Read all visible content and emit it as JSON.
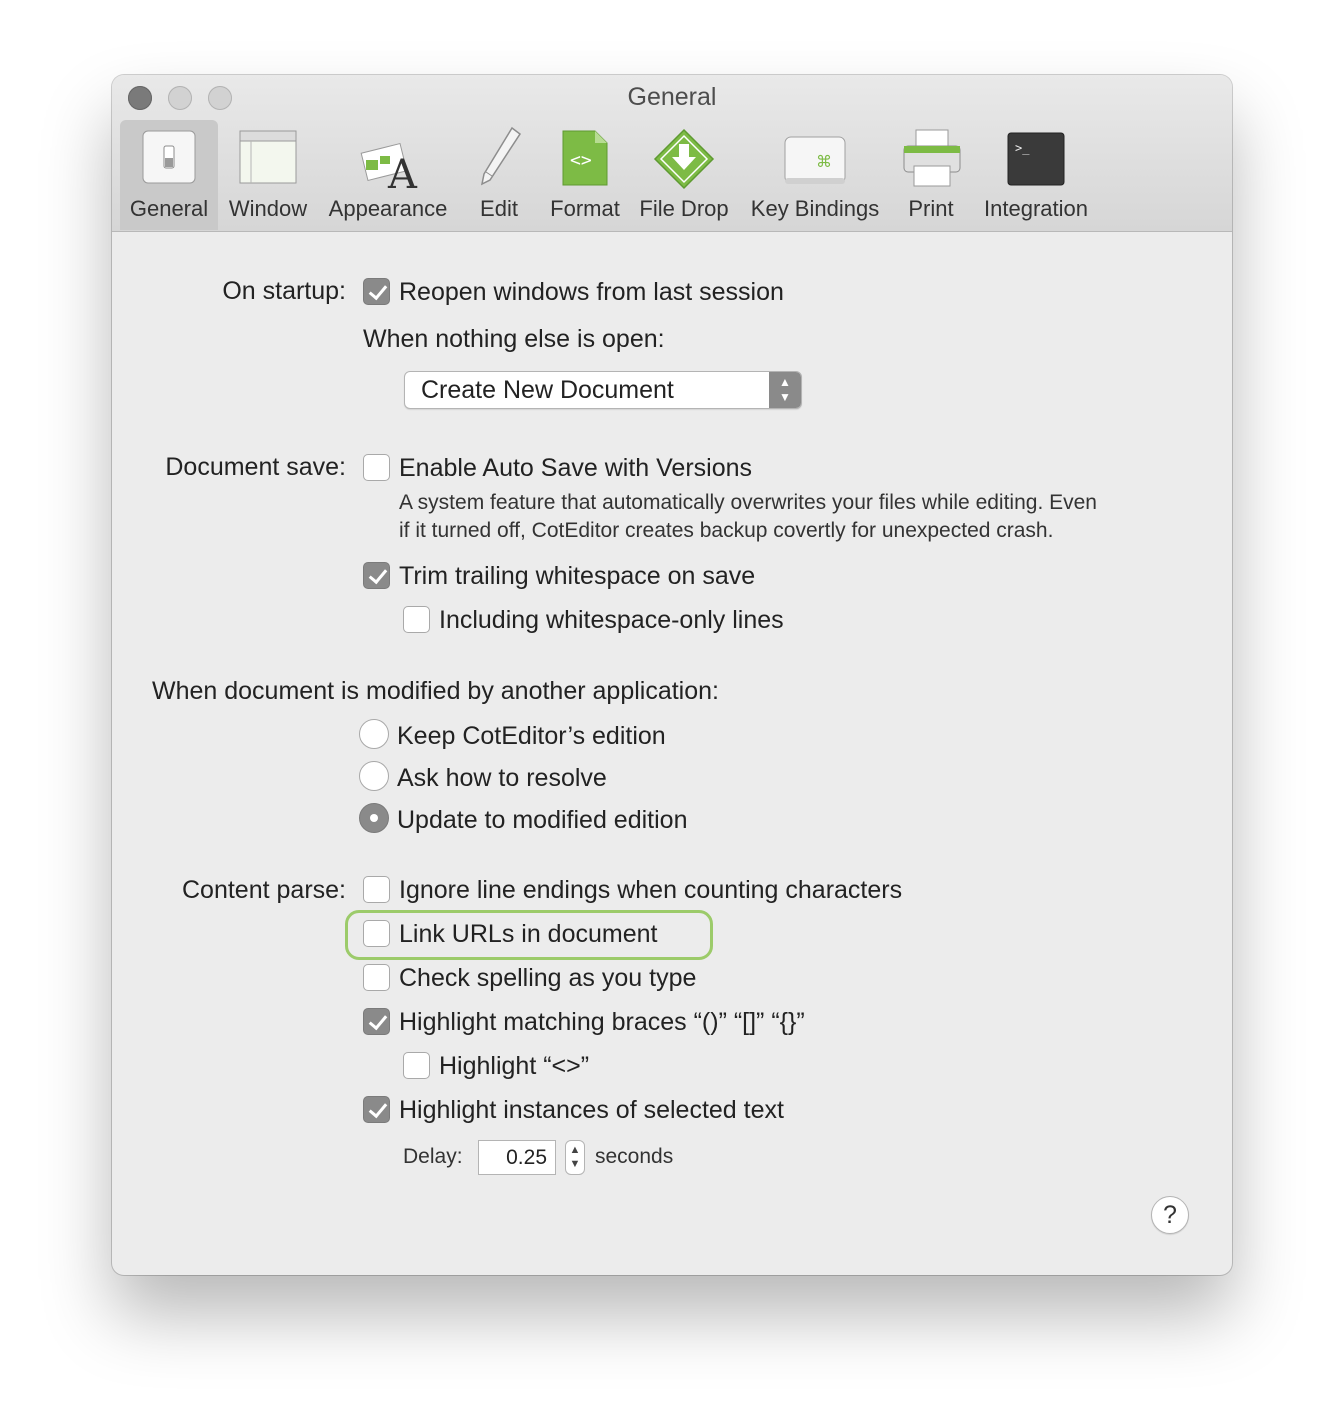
{
  "window": {
    "title": "General"
  },
  "toolbar": {
    "items": [
      {
        "label": "General",
        "icon": "general-switch-icon",
        "active": true
      },
      {
        "label": "Window",
        "icon": "window-icon"
      },
      {
        "label": "Appearance",
        "icon": "appearance-icon"
      },
      {
        "label": "Edit",
        "icon": "pencil-icon"
      },
      {
        "label": "Format",
        "icon": "format-file-icon"
      },
      {
        "label": "File Drop",
        "icon": "file-drop-icon"
      },
      {
        "label": "Key Bindings",
        "icon": "command-key-icon"
      },
      {
        "label": "Print",
        "icon": "printer-icon"
      },
      {
        "label": "Integration",
        "icon": "terminal-icon"
      }
    ]
  },
  "startup": {
    "label": "On startup:",
    "reopen": {
      "label": "Reopen windows from last session",
      "checked": true
    },
    "nothing_open_label": "When nothing else is open:",
    "popup_value": "Create New Document"
  },
  "save": {
    "label": "Document save:",
    "autosave": {
      "label": "Enable Auto Save with Versions",
      "checked": false
    },
    "note_line1": "A system feature that automatically overwrites your files while editing. Even",
    "note_line2": "if it turned off, CotEditor creates backup covertly for unexpected crash.",
    "trim": {
      "label": "Trim trailing whitespace on save",
      "checked": true
    },
    "including": {
      "label": "Including whitespace-only lines",
      "checked": false
    }
  },
  "modified": {
    "label": "When document is modified by another application:",
    "options": [
      {
        "label": "Keep CotEditor’s edition",
        "selected": false
      },
      {
        "label": "Ask how to resolve",
        "selected": false
      },
      {
        "label": "Update to modified edition",
        "selected": true
      }
    ]
  },
  "parse": {
    "label": "Content parse:",
    "ignore_line_endings": {
      "label": "Ignore line endings when counting characters",
      "checked": false
    },
    "link_urls": {
      "label": "Link URLs in document",
      "checked": false
    },
    "spelling": {
      "label": "Check spelling as you type",
      "checked": false
    },
    "braces": {
      "label": "Highlight matching braces “()” “[]” “{}”",
      "checked": true
    },
    "angle": {
      "label": "Highlight “<>”",
      "checked": false
    },
    "instances": {
      "label": "Highlight instances of selected text",
      "checked": true
    },
    "delay_label": "Delay:",
    "delay_value": "0.25",
    "delay_unit": "seconds"
  },
  "help_label": "?",
  "colors": {
    "highlight_ring": "#9ccb6a",
    "format_green": "#7dbb45",
    "checkbox_on": "#8a8a8a"
  }
}
